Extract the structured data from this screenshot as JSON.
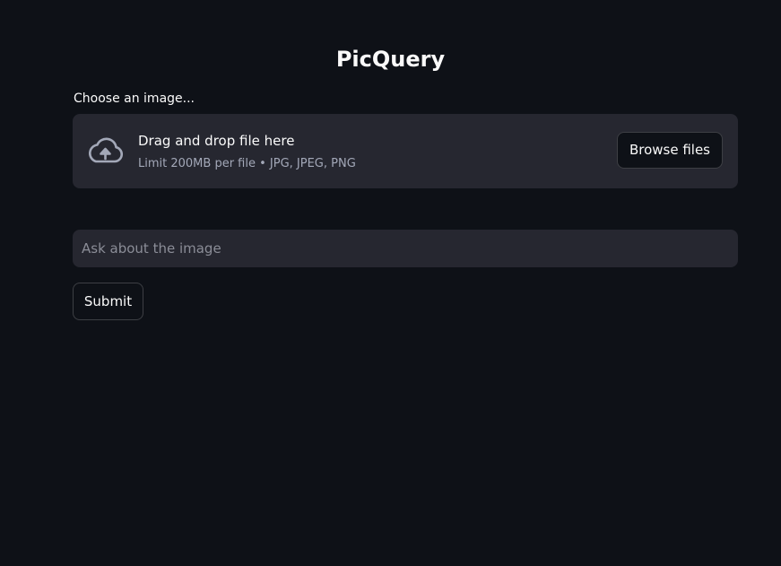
{
  "app": {
    "title": "PicQuery"
  },
  "uploader": {
    "label": "Choose an image...",
    "drop_text": "Drag and drop file here",
    "limit_text": "Limit 200MB per file • JPG, JPEG, PNG",
    "browse_label": "Browse files",
    "icon": "cloud-upload-icon"
  },
  "query": {
    "placeholder": "Ask about the image",
    "value": ""
  },
  "submit": {
    "label": "Submit"
  },
  "colors": {
    "background": "#0e1117",
    "surface": "#262730",
    "text": "#fafafa",
    "muted": "#a3a8b8"
  }
}
